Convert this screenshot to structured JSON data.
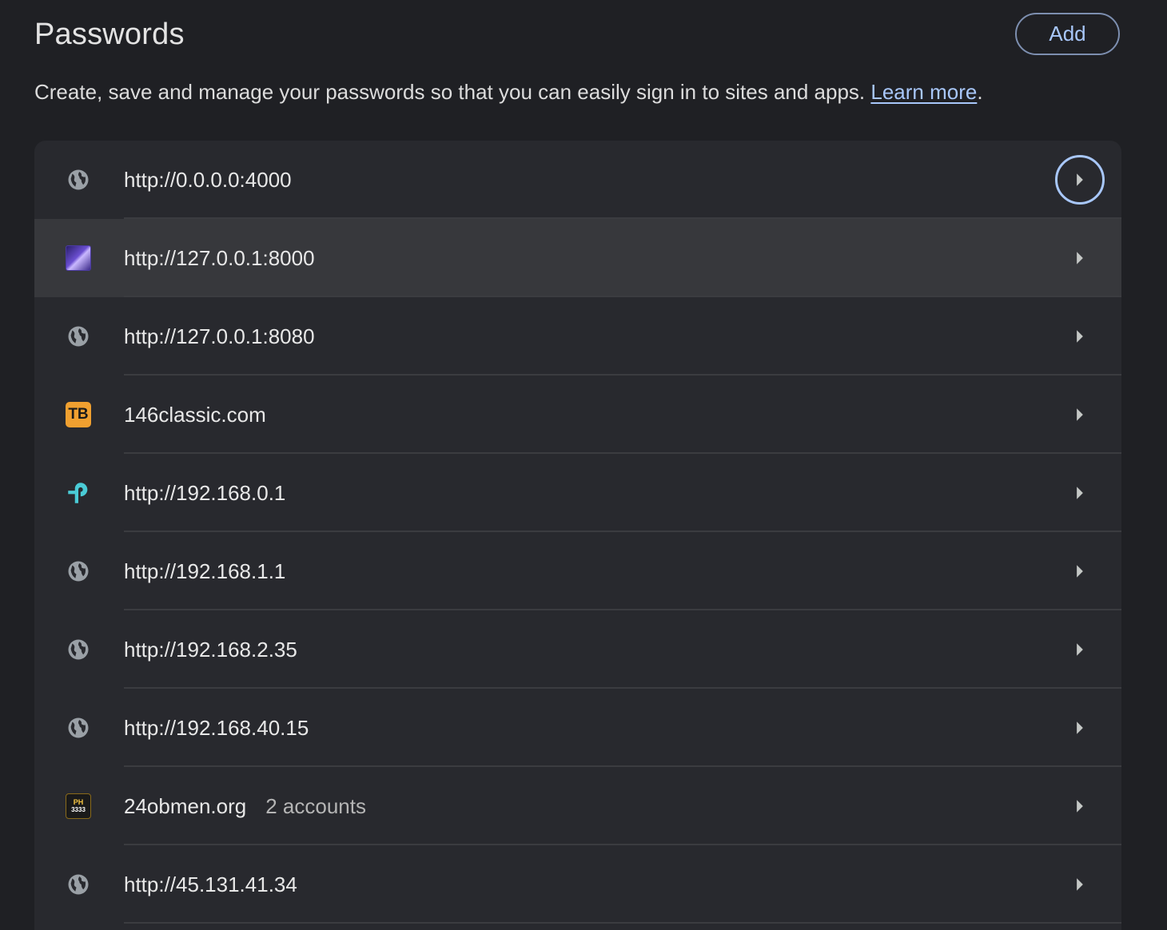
{
  "header": {
    "title": "Passwords",
    "add_label": "Add"
  },
  "description": {
    "text": "Create, save and manage your passwords so that you can easily sign in to sites and apps. ",
    "link_label": "Learn more",
    "suffix": "."
  },
  "colors": {
    "background": "#1f2024",
    "card": "#28292e",
    "hover_row": "#37383c",
    "accent": "#a8c7fa",
    "tb_badge": "#f0a030",
    "tplink": "#4acbd6"
  },
  "rows": [
    {
      "site": "http://0.0.0.0:4000",
      "icon": "globe-icon",
      "accounts": ""
    },
    {
      "site": "http://127.0.0.1:8000",
      "icon": "site-favicon-art",
      "accounts": ""
    },
    {
      "site": "http://127.0.0.1:8080",
      "icon": "globe-icon",
      "accounts": ""
    },
    {
      "site": "146classic.com",
      "icon": "tb-favicon",
      "accounts": "",
      "badge_text": "TB"
    },
    {
      "site": "http://192.168.0.1",
      "icon": "tplink-favicon",
      "accounts": ""
    },
    {
      "site": "http://192.168.1.1",
      "icon": "globe-icon",
      "accounts": ""
    },
    {
      "site": "http://192.168.2.35",
      "icon": "globe-icon",
      "accounts": ""
    },
    {
      "site": "http://192.168.40.15",
      "icon": "globe-icon",
      "accounts": ""
    },
    {
      "site": "24obmen.org",
      "icon": "ph-favicon",
      "accounts": "2 accounts",
      "badge_line1": "PH",
      "badge_line2": "3333"
    },
    {
      "site": "http://45.131.41.34",
      "icon": "globe-icon",
      "accounts": ""
    }
  ]
}
